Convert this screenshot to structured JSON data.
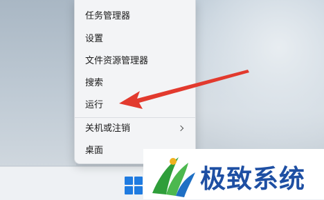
{
  "context_menu": {
    "items": [
      {
        "label": "任务管理器"
      },
      {
        "label": "设置"
      },
      {
        "label": "文件资源管理器"
      },
      {
        "label": "搜索"
      },
      {
        "label": "运行"
      },
      {
        "label": "关机或注销",
        "has_submenu": true
      },
      {
        "label": "桌面"
      }
    ]
  },
  "watermark": {
    "text": "极致系统"
  },
  "colors": {
    "arrow": "#e23a2e",
    "start_icon": "#1f7be0",
    "watermark_text": "#1e4fa3"
  }
}
